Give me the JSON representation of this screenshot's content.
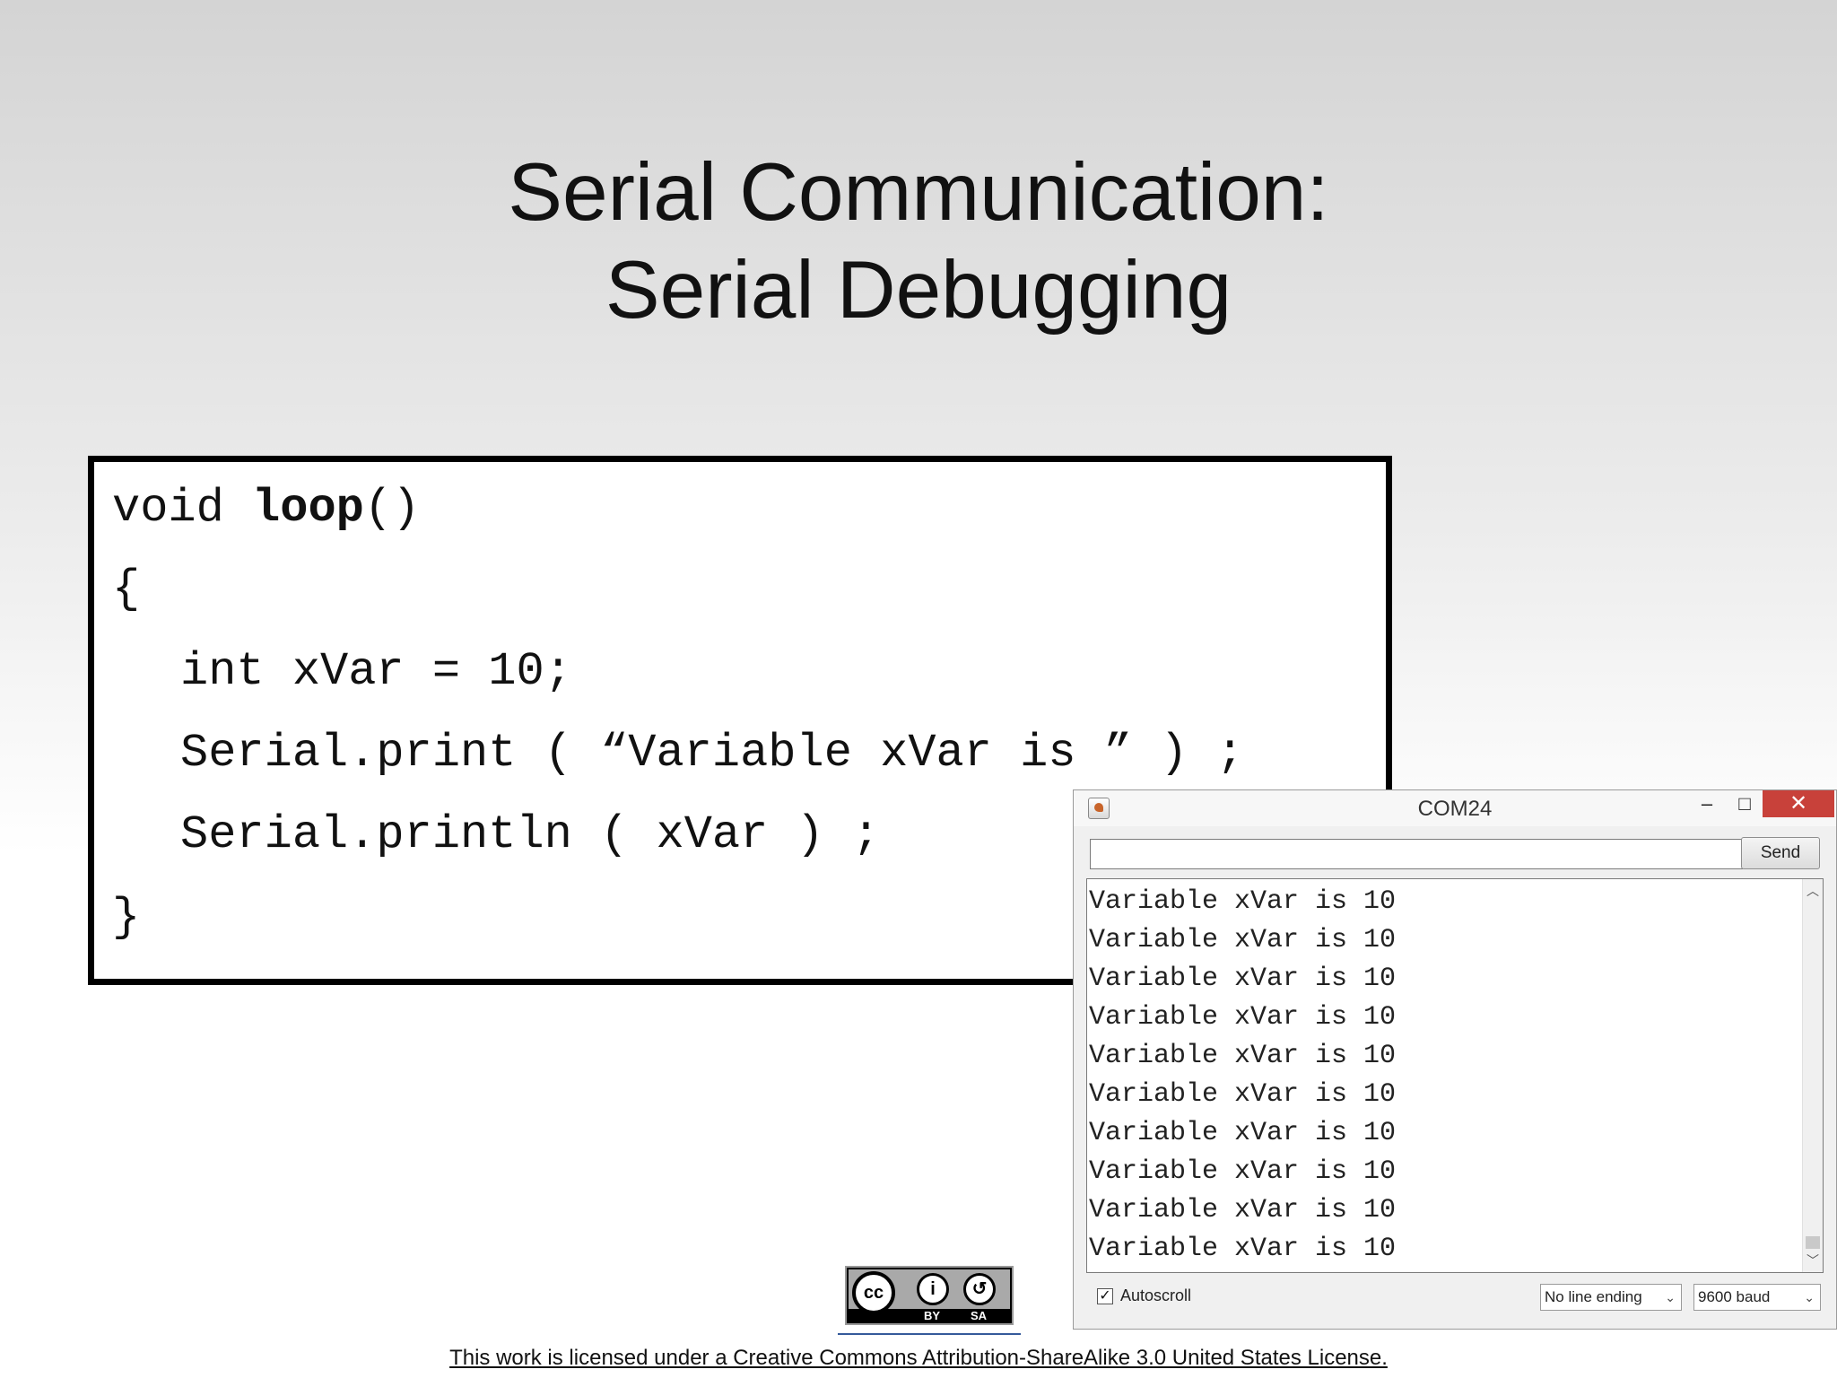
{
  "slide": {
    "title_line1": "Serial Communication:",
    "title_line2": "Serial Debugging"
  },
  "code": {
    "line1_keyword": "void ",
    "line1_name": "loop",
    "line1_parens": "()",
    "line2": "{",
    "line3": "int xVar = 10;",
    "line4": "Serial.print ( “Variable xVar is ” ) ;",
    "line5": "Serial.println ( xVar ) ;",
    "line6": "}"
  },
  "serial_monitor": {
    "title": "COM24",
    "minimize_glyph": "–",
    "maximize_glyph": "□",
    "close_glyph": "✕",
    "input_value": "",
    "send_label": "Send",
    "output_lines": [
      "Variable xVar is 10",
      "Variable xVar is 10",
      "Variable xVar is 10",
      "Variable xVar is 10",
      "Variable xVar is 10",
      "Variable xVar is 10",
      "Variable xVar is 10",
      "Variable xVar is 10",
      "Variable xVar is 10",
      "Variable xVar is 10"
    ],
    "autoscroll_label": "Autoscroll",
    "autoscroll_checked": true,
    "line_ending_selected": "No line ending",
    "baud_selected": "9600 baud"
  },
  "license_badge": {
    "cc": "cc",
    "by": "BY",
    "sa": "SA"
  },
  "license_text": "This work is licensed under a Creative Commons Attribution-ShareAlike 3.0 United States License.",
  "colors": {
    "close_button": "#c8413a",
    "link_underline": "#355a9a"
  },
  "icons": [
    "app-icon",
    "minimize-icon",
    "maximize-icon",
    "close-icon",
    "scroll-up-icon",
    "scroll-down-icon",
    "checkbox-check-icon",
    "chevron-down-icon",
    "cc-icon",
    "attribution-icon",
    "share-alike-icon"
  ]
}
